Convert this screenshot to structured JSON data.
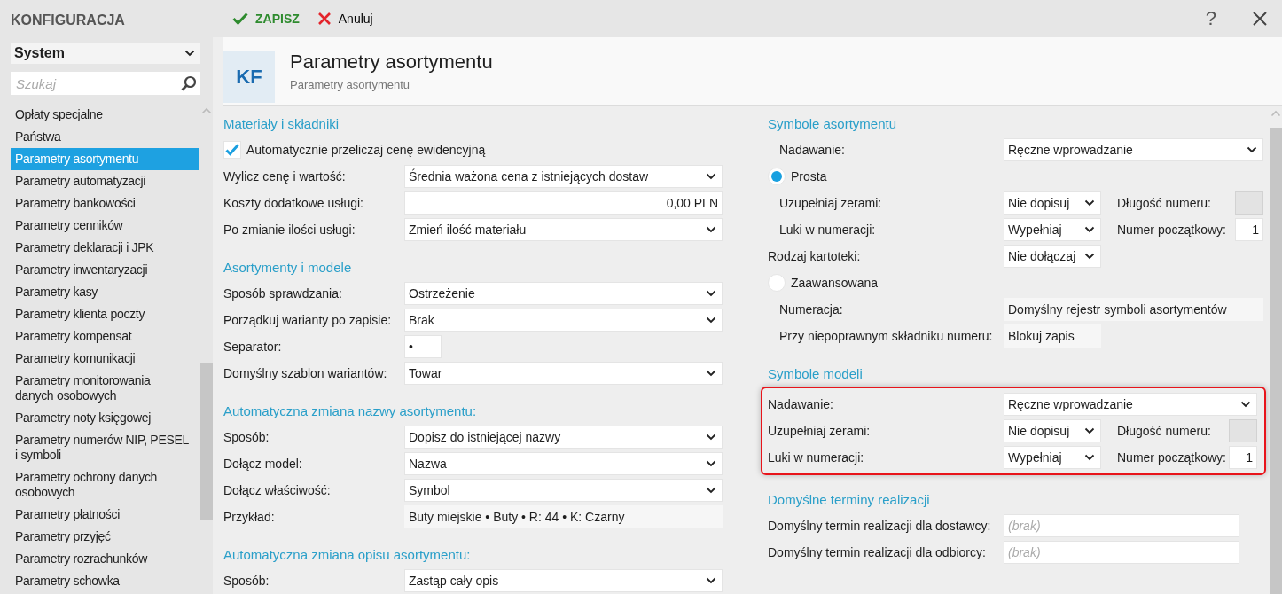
{
  "sidebar": {
    "title": "KONFIGURACJA",
    "category": "System",
    "search": {
      "placeholder": "Szukaj"
    },
    "items": [
      {
        "label": "Opłaty specjalne",
        "selected": false
      },
      {
        "label": "Państwa",
        "selected": false
      },
      {
        "label": "Parametry asortymentu",
        "selected": true
      },
      {
        "label": "Parametry automatyzacji",
        "selected": false
      },
      {
        "label": "Parametry bankowości",
        "selected": false
      },
      {
        "label": "Parametry cenników",
        "selected": false
      },
      {
        "label": "Parametry deklaracji i JPK",
        "selected": false
      },
      {
        "label": "Parametry inwentaryzacji",
        "selected": false
      },
      {
        "label": "Parametry kasy",
        "selected": false
      },
      {
        "label": "Parametry klienta poczty",
        "selected": false
      },
      {
        "label": "Parametry kompensat",
        "selected": false
      },
      {
        "label": "Parametry komunikacji",
        "selected": false
      },
      {
        "label": "Parametry monitorowania danych osobowych",
        "selected": false
      },
      {
        "label": "Parametry noty księgowej",
        "selected": false
      },
      {
        "label": "Parametry numerów NIP, PESEL i symboli",
        "selected": false
      },
      {
        "label": "Parametry ochrony danych osobowych",
        "selected": false
      },
      {
        "label": "Parametry płatności",
        "selected": false
      },
      {
        "label": "Parametry przyjęć",
        "selected": false
      },
      {
        "label": "Parametry rozrachunków",
        "selected": false
      },
      {
        "label": "Parametry schowka",
        "selected": false
      }
    ]
  },
  "toolbar": {
    "save": "ZAPISZ",
    "cancel": "Anuluj",
    "help": "?"
  },
  "header": {
    "badge": "KF",
    "title": "Parametry asortymentu",
    "subtitle": "Parametry asortymentu"
  },
  "left_sections": [
    {
      "title": "Materiały i składniki",
      "rows": [
        {
          "kind": "checkbox",
          "label": "Automatycznie przeliczaj cenę ewidencyjną",
          "checked": true
        },
        {
          "kind": "select",
          "label": "Wylicz cenę i wartość:",
          "value": "Średnia ważona cena z istniejących dostaw"
        },
        {
          "kind": "amount",
          "label": "Koszty dodatkowe usługi:",
          "value": "0,00 PLN"
        },
        {
          "kind": "select",
          "label": "Po zmianie ilości usługi:",
          "value": "Zmień ilość materiału"
        }
      ]
    },
    {
      "title": "Asortymenty i modele",
      "rows": [
        {
          "kind": "select",
          "label": "Sposób sprawdzania:",
          "value": "Ostrzeżenie"
        },
        {
          "kind": "select",
          "label": "Porządkuj warianty po zapisie:",
          "value": "Brak"
        },
        {
          "kind": "short_input",
          "label": "Separator:",
          "value": "•"
        },
        {
          "kind": "select",
          "label": "Domyślny szablon wariantów:",
          "value": "Towar"
        }
      ]
    },
    {
      "title": "Automatyczna zmiana nazwy asortymentu:",
      "rows": [
        {
          "kind": "select",
          "label": "Sposób:",
          "value": "Dopisz do istniejącej nazwy"
        },
        {
          "kind": "select",
          "label": "Dołącz model:",
          "value": "Nazwa"
        },
        {
          "kind": "select",
          "label": "Dołącz właściwość:",
          "value": "Symbol"
        },
        {
          "kind": "readonly",
          "label": "Przykład:",
          "value": "Buty miejskie • Buty • R: 44 • K: Czarny"
        }
      ]
    },
    {
      "title": "Automatyczna zmiana opisu asortymentu:",
      "rows": [
        {
          "kind": "select",
          "label": "Sposób:",
          "value": "Zastąp cały opis"
        }
      ]
    }
  ],
  "right_sections": [
    {
      "title": "Symbole asortymentu",
      "highlighted": false,
      "rows": [
        {
          "kind": "select",
          "label": "Nadawanie:",
          "value": "Ręczne wprowadzanie",
          "indented": true
        },
        {
          "kind": "radio",
          "label": "Prosta",
          "selected": true,
          "children": [
            {
              "kind": "pair",
              "label": "Uzupełniaj zerami:",
              "value": "Nie dopisuj",
              "side_label": "Długość numeru:",
              "side_disabled": true
            },
            {
              "kind": "pair",
              "label": "Luki w numeracji:",
              "value": "Wypełniaj",
              "side_label": "Numer początkowy:",
              "side_value": "1",
              "side_disabled": false
            }
          ]
        },
        {
          "kind": "select_short",
          "label": "Rodzaj kartoteki:",
          "value": "Nie dołączaj"
        },
        {
          "kind": "radio",
          "label": "Zaawansowana",
          "selected": false,
          "children": [
            {
              "kind": "readonly",
              "label": "Numeracja:",
              "value": "Domyślny rejestr symboli asortymentów"
            },
            {
              "kind": "readonly_short",
              "label": "Przy niepoprawnym składniku numeru:",
              "value": "Blokuj zapis"
            }
          ]
        }
      ]
    },
    {
      "title": "Symbole modeli",
      "highlighted": true,
      "rows": [
        {
          "kind": "select",
          "label": "Nadawanie:",
          "value": "Ręczne wprowadzanie"
        },
        {
          "kind": "pair",
          "label": "Uzupełniaj zerami:",
          "value": "Nie dopisuj",
          "side_label": "Długość numeru:",
          "side_disabled": true
        },
        {
          "kind": "pair",
          "label": "Luki w numeracji:",
          "value": "Wypełniaj",
          "side_label": "Numer początkowy:",
          "side_value": "1",
          "side_disabled": false
        }
      ]
    },
    {
      "title": "Domyślne terminy realizacji",
      "highlighted": false,
      "rows": [
        {
          "kind": "placeholder_input",
          "label": "Domyślny termin realizacji dla dostawcy:",
          "placeholder": "(brak)"
        },
        {
          "kind": "placeholder_input",
          "label": "Domyślny termin realizacji dla odbiorcy:",
          "placeholder": "(brak)"
        }
      ]
    }
  ]
}
